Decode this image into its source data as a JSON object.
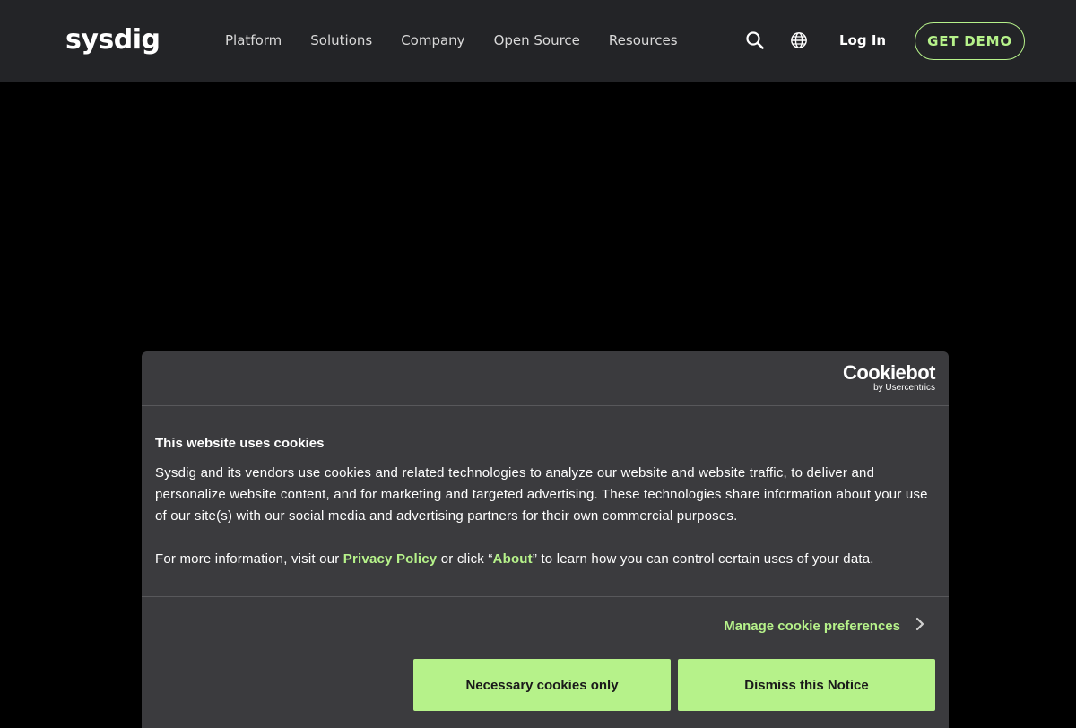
{
  "header": {
    "logo": "sysdig",
    "nav": [
      "Platform",
      "Solutions",
      "Company",
      "Open Source",
      "Resources"
    ],
    "search_icon": "search-icon",
    "globe_icon": "globe-icon",
    "login_label": "Log In",
    "demo_label": "GET DEMO",
    "accent_color": "#b6f28a"
  },
  "cookie_banner": {
    "brand": "Cookiebot",
    "brand_sub": "by Usercentrics",
    "title": "This website uses cookies",
    "text": "Sysdig and its vendors use cookies and related technologies to analyze our website and website traffic, to deliver and personalize website content, and for marketing and targeted advertising. These technologies share information about your use of our site(s) with our social media and advertising partners for their own commercial purposes.",
    "more_prefix": "For more information, visit our ",
    "privacy_link": "Privacy Policy",
    "more_mid": " or click “",
    "about_link": "About",
    "more_suffix": "” to learn how you can control certain uses of your data.",
    "manage_label": "Manage cookie preferences",
    "manage_icon": "chevron-right-icon",
    "btn_necessary": "Necessary cookies only",
    "btn_dismiss": "Dismiss this Notice"
  }
}
